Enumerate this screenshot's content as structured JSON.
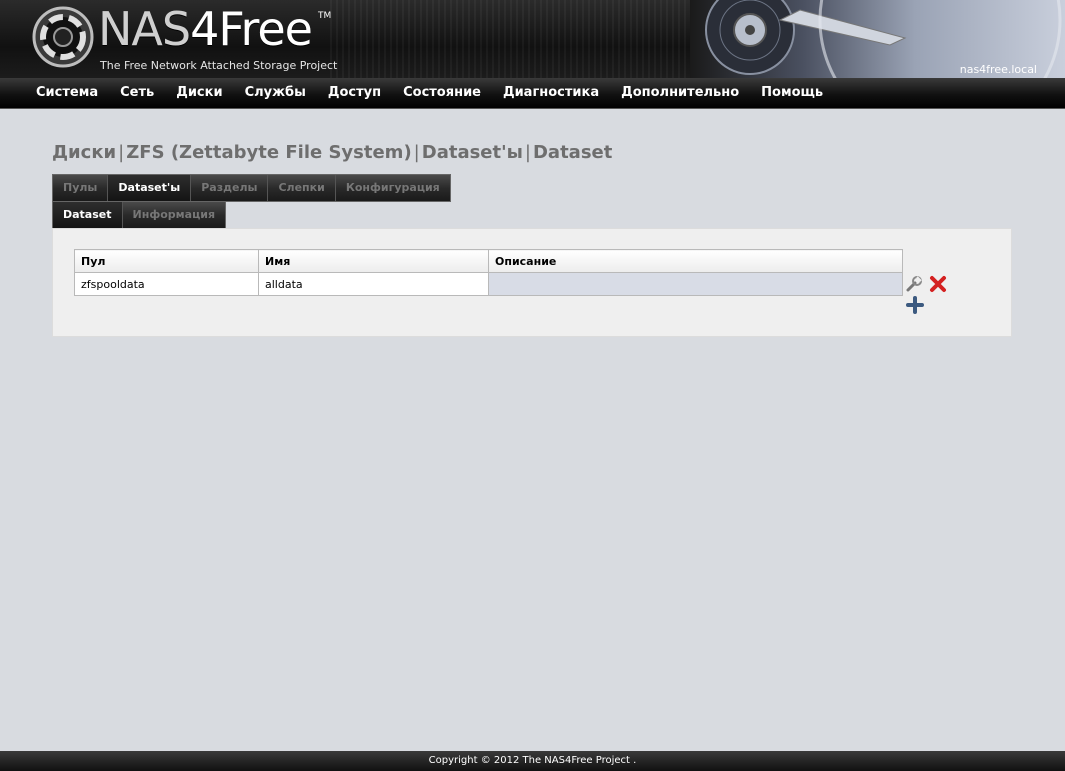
{
  "header": {
    "logo_main": "NAS",
    "logo_four": "4Free",
    "logo_tm": "TM",
    "tagline": "The Free Network Attached Storage Project",
    "hostname": "nas4free.local"
  },
  "nav": {
    "items": [
      "Система",
      "Сеть",
      "Диски",
      "Службы",
      "Доступ",
      "Состояние",
      "Диагностика",
      "Дополнительно",
      "Помощь"
    ]
  },
  "breadcrumb": {
    "parts": [
      "Диски",
      "ZFS (Zettabyte File System)",
      "Dataset'ы",
      "Dataset"
    ],
    "separator": "|"
  },
  "tabs_primary": [
    {
      "label": "Пулы",
      "active": false
    },
    {
      "label": "Dataset'ы",
      "active": true
    },
    {
      "label": "Разделы",
      "active": false
    },
    {
      "label": "Слепки",
      "active": false
    },
    {
      "label": "Конфигурация",
      "active": false
    }
  ],
  "tabs_secondary": [
    {
      "label": "Dataset",
      "active": true
    },
    {
      "label": "Информация",
      "active": false
    }
  ],
  "table": {
    "headers": [
      "Пул",
      "Имя",
      "Описание"
    ],
    "rows": [
      {
        "pool": "zfspooldata",
        "name": "alldata",
        "description": ""
      }
    ]
  },
  "icons": {
    "edit": "wrench-icon",
    "delete": "delete-x-icon",
    "add": "plus-icon"
  },
  "colors": {
    "delete": "#d42020",
    "add": "#3c5a80"
  },
  "footer": {
    "text": "Copyright © 2012 The NAS4Free Project ."
  }
}
